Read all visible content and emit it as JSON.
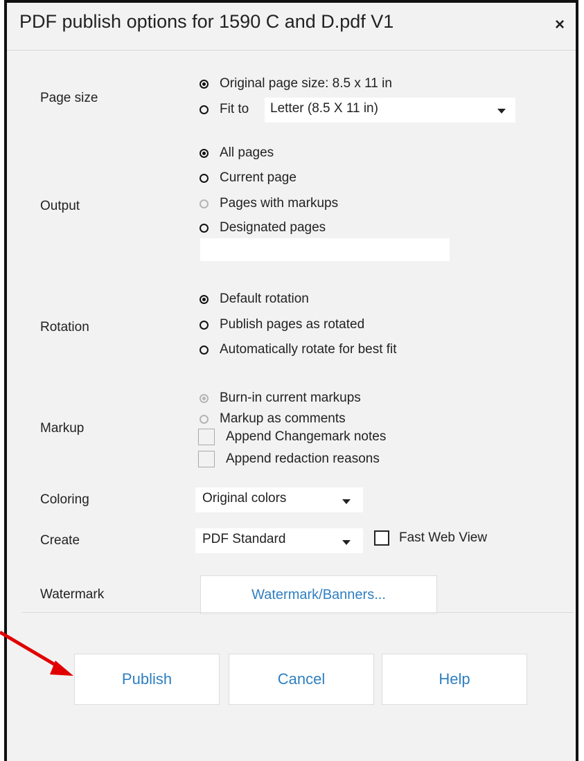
{
  "dialog": {
    "title": "PDF publish options for 1590 C and D.pdf V1",
    "close_glyph": "×"
  },
  "page_size": {
    "label": "Page size",
    "original_option": "Original page size: 8.5 x 11 in",
    "fit_option": "Fit to",
    "fit_select_value": "Letter (8.5 X 11 in)"
  },
  "output": {
    "label": "Output",
    "options": [
      "All pages",
      "Current page",
      "Pages with markups",
      "Designated pages"
    ],
    "designated_value": ""
  },
  "rotation": {
    "label": "Rotation",
    "options": [
      "Default rotation",
      "Publish pages as rotated",
      "Automatically rotate for best fit"
    ]
  },
  "markup": {
    "label": "Markup",
    "radios": [
      "Burn-in current markups",
      "Markup as comments"
    ],
    "checkboxes": [
      "Append Changemark notes",
      "Append redaction reasons"
    ]
  },
  "coloring": {
    "label": "Coloring",
    "value": "Original colors"
  },
  "create": {
    "label": "Create",
    "value": "PDF Standard",
    "fast_web_view": "Fast Web View"
  },
  "watermark": {
    "label": "Watermark",
    "button": "Watermark/Banners..."
  },
  "buttons": {
    "publish": "Publish",
    "cancel": "Cancel",
    "help": "Help"
  },
  "colors": {
    "link_blue": "#2f7fc1",
    "annotation_arrow": "#e00000"
  }
}
